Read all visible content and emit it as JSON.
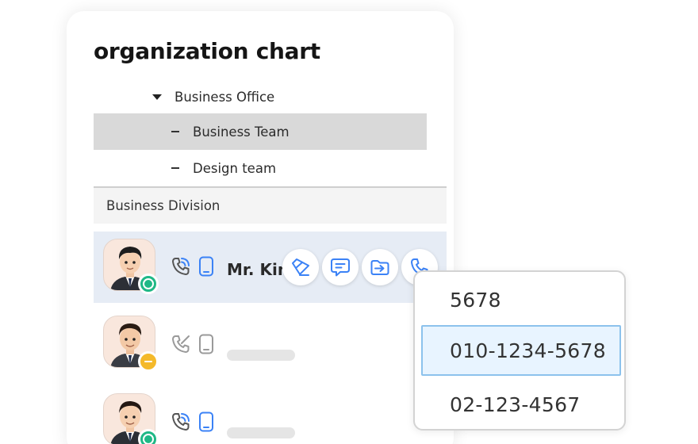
{
  "panel": {
    "title": "organization chart"
  },
  "tree": {
    "parent": "Business Office",
    "children": [
      {
        "label": "Business Team",
        "selected": true
      },
      {
        "label": "Design team",
        "selected": false
      }
    ]
  },
  "division": {
    "label": "Business Division"
  },
  "members": [
    {
      "name": "Mr. Kim",
      "status": "online"
    },
    {
      "name": "",
      "status": "away"
    },
    {
      "name": "",
      "status": "online"
    }
  ],
  "actions": [
    "eraser-icon",
    "chat-icon",
    "transfer-icon",
    "phone-icon"
  ],
  "phone_dropdown": {
    "options": [
      "5678",
      "010-1234-5678",
      "02-123-4567"
    ],
    "selected": "010-1234-5678"
  },
  "colors": {
    "accent": "#3b82f6",
    "online": "#1fb886",
    "away": "#f4b92a",
    "selected_row": "#e6ecf5",
    "dropdown_selected": "#e8f4ff"
  }
}
